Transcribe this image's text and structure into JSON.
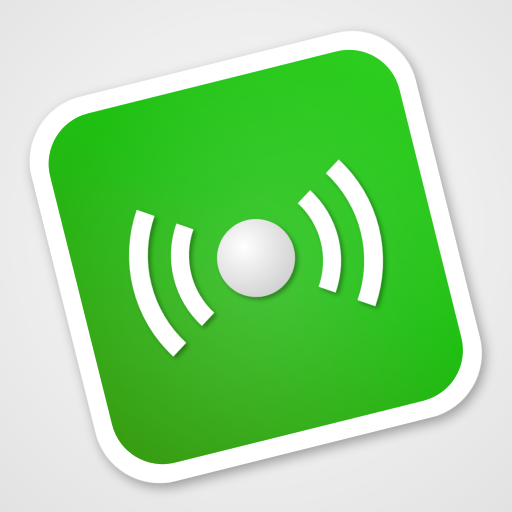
{
  "icon": {
    "name": "wireless-broadcast-icon",
    "colors": {
      "tile_light": "#2fcf22",
      "tile_mid": "#1fbf12",
      "tile_dark": "#3a9a12",
      "sticker_border": "#ffffff",
      "waves": "#ffffff",
      "center_dot_light": "#ffffff",
      "center_dot_dark": "#cfcfcf",
      "background": "#eeeeee"
    }
  }
}
